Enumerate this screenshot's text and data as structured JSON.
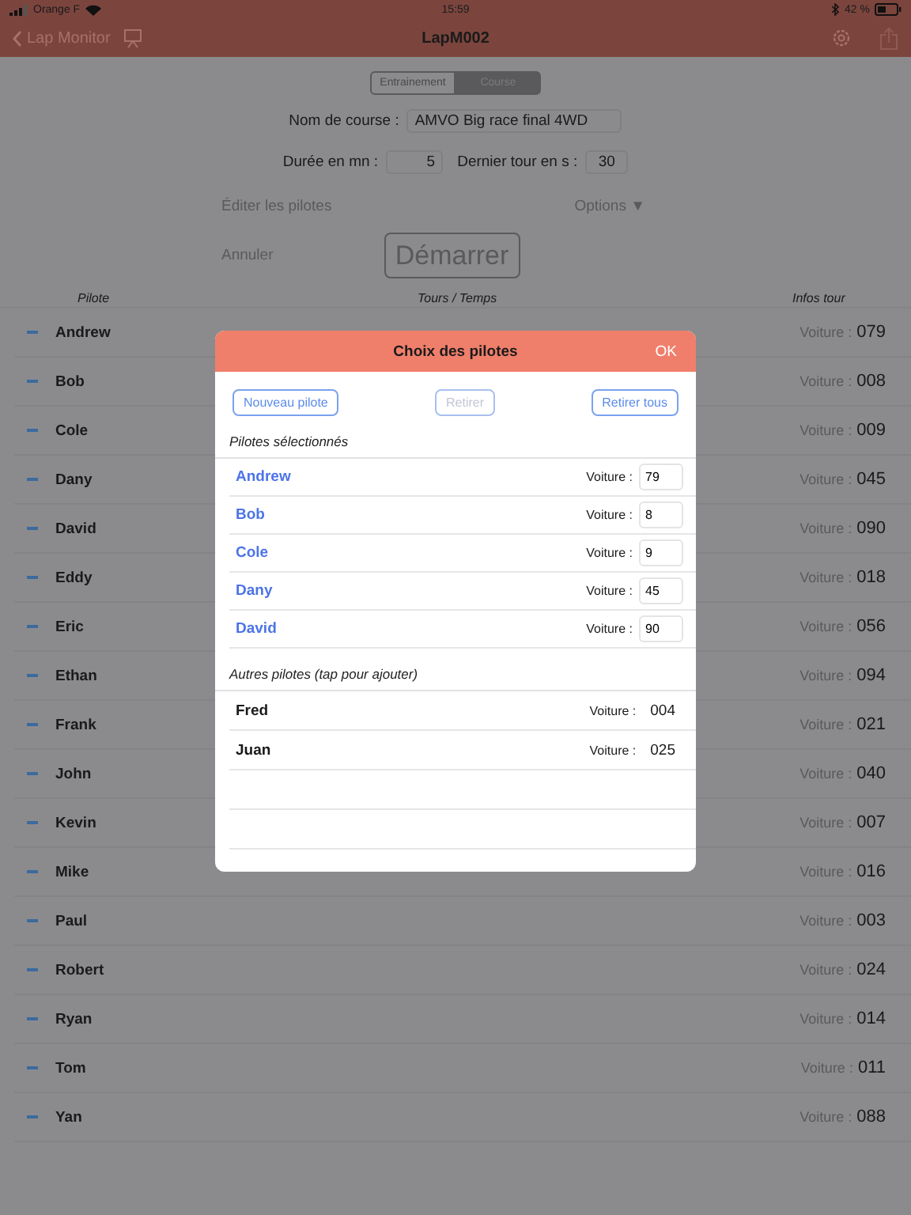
{
  "status_bar": {
    "carrier": "Orange F",
    "time": "15:59",
    "battery": "42 %"
  },
  "nav": {
    "back": "Lap Monitor",
    "title": "LapM002"
  },
  "mode_tabs": [
    {
      "label": "Entrainement",
      "selected": false
    },
    {
      "label": "Course",
      "selected": true
    }
  ],
  "form": {
    "race_name_label": "Nom de course :",
    "race_name": "AMVO Big race final 4WD",
    "duration_label": "Durée en mn :",
    "duration": "5",
    "last_lap_label": "Dernier tour en s :",
    "last_lap": "30"
  },
  "edit_drivers": "Éditer les pilotes",
  "options": "Options ▼",
  "cancel": "Annuler",
  "start": "Démarrer",
  "table": {
    "columns": [
      "Pilote",
      "Tours / Temps",
      "Infos tour"
    ],
    "rows": [
      {
        "name": "Andrew",
        "car_label": "Voiture :",
        "car": "079"
      },
      {
        "name": "Bob",
        "car_label": "Voiture :",
        "car": "008"
      },
      {
        "name": "Cole",
        "car_label": "Voiture :",
        "car": "009"
      },
      {
        "name": "Dany",
        "car_label": "Voiture :",
        "car": "045"
      },
      {
        "name": "David",
        "car_label": "Voiture :",
        "car": "090"
      },
      {
        "name": "Eddy",
        "car_label": "Voiture :",
        "car": "018"
      },
      {
        "name": "Eric",
        "car_label": "Voiture :",
        "car": "056"
      },
      {
        "name": "Ethan",
        "car_label": "Voiture :",
        "car": "094"
      },
      {
        "name": "Frank",
        "car_label": "Voiture :",
        "car": "021"
      },
      {
        "name": "John",
        "car_label": "Voiture :",
        "car": "040"
      },
      {
        "name": "Kevin",
        "car_label": "Voiture :",
        "car": "007"
      },
      {
        "name": "Mike",
        "car_label": "Voiture :",
        "car": "016"
      },
      {
        "name": "Paul",
        "car_label": "Voiture :",
        "car": "003"
      },
      {
        "name": "Robert",
        "car_label": "Voiture :",
        "car": "024"
      },
      {
        "name": "Ryan",
        "car_label": "Voiture :",
        "car": "014"
      },
      {
        "name": "Tom",
        "car_label": "Voiture :",
        "car": "011"
      },
      {
        "name": "Yan",
        "car_label": "Voiture :",
        "car": "088"
      }
    ]
  },
  "dialog": {
    "title": "Choix des pilotes",
    "ok": "OK",
    "buttons": [
      {
        "label": "Nouveau pilote",
        "disabled": false
      },
      {
        "label": "Retirer",
        "disabled": true
      },
      {
        "label": "Retirer tous",
        "disabled": false
      }
    ],
    "selected_heading": "Pilotes sélectionnés",
    "selected": [
      {
        "name": "Andrew",
        "car_label": "Voiture :",
        "car": "79"
      },
      {
        "name": "Bob",
        "car_label": "Voiture :",
        "car": "8"
      },
      {
        "name": "Cole",
        "car_label": "Voiture :",
        "car": "9"
      },
      {
        "name": "Dany",
        "car_label": "Voiture :",
        "car": "45"
      },
      {
        "name": "David",
        "car_label": "Voiture :",
        "car": "90"
      }
    ],
    "others_heading": "Autres pilotes (tap pour ajouter)",
    "others": [
      {
        "name": "Fred",
        "car_label": "Voiture :",
        "car": "004"
      },
      {
        "name": "Juan",
        "car_label": "Voiture :",
        "car": "025"
      }
    ]
  }
}
